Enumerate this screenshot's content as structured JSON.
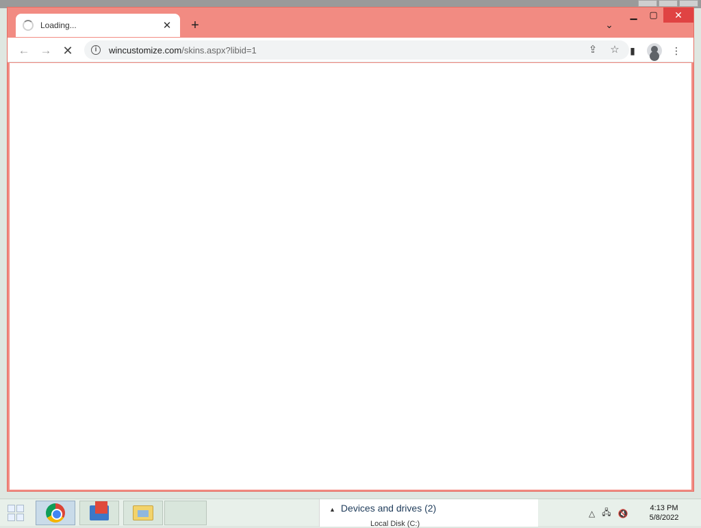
{
  "browser": {
    "tab_title": "Loading...",
    "tab_close": "✕",
    "new_tab": "+",
    "tab_search": "⌄",
    "url_domain": "wincustomize.com",
    "url_path": "/skins.aspx?libid=1",
    "colors": {
      "frame": "#f28b82",
      "close_button": "#e04343"
    }
  },
  "taskbar": {
    "devices_title": "Devices and drives (2)",
    "devices_sub": "Local Disk (C:)",
    "clock_time": "4:13 PM",
    "clock_date": "5/8/2022"
  }
}
